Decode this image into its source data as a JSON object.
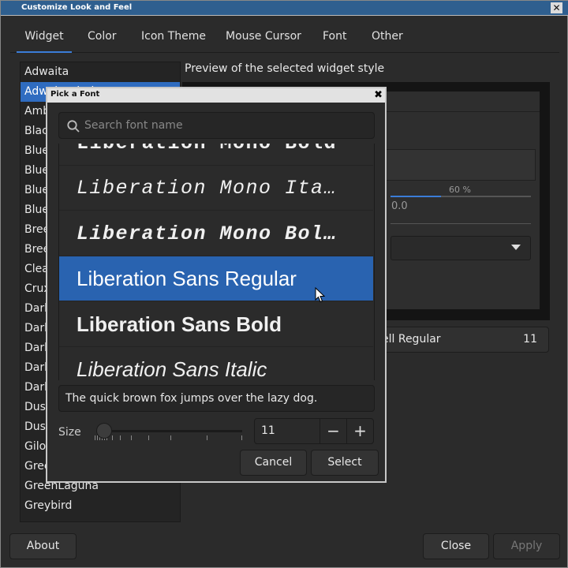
{
  "window": {
    "title": "Customize Look and Feel",
    "close_glyph": "✕"
  },
  "tabs": [
    {
      "label": "Widget",
      "active": true
    },
    {
      "label": "Color"
    },
    {
      "label": "Icon Theme"
    },
    {
      "label": "Mouse Cursor"
    },
    {
      "label": "Font"
    },
    {
      "label": "Other"
    }
  ],
  "themes": [
    "Adwaita",
    "Adwaita-dark",
    "Ambiance",
    "Blackbird",
    "Bluebird",
    "Bluebird-dark",
    "BlueMenta",
    "Blue-Submarine",
    "Breeze",
    "Breeze-Dark",
    "Clearlooks",
    "Crux",
    "Darkbird",
    "Darkcold",
    "Darkfire",
    "Darkmint",
    "Dark-Submarine",
    "Dusk",
    "Dust",
    "Gilouche",
    "Greenbird",
    "GreenLaguna",
    "Greybird"
  ],
  "selected_theme_index": 1,
  "preview": {
    "label": "Preview of the selected widget style",
    "progress_label": "60 %",
    "progress_value": 0.6,
    "value_text": "0.0"
  },
  "font_button": {
    "name": "ell Regular",
    "size": "11"
  },
  "footer": {
    "about": "About",
    "close": "Close",
    "apply": "Apply"
  },
  "dialog": {
    "title": "Pick a Font",
    "close_glyph": "✖",
    "search_placeholder": "Search font name",
    "fonts": [
      {
        "label": "Liberation Mono Bold",
        "family": "mono",
        "style": "bold"
      },
      {
        "label": "Liberation Mono Ita…",
        "family": "mono",
        "style": "italic"
      },
      {
        "label": "Liberation Mono Bol…",
        "family": "mono",
        "style": "bolditalic"
      },
      {
        "label": "Liberation Sans Regular",
        "family": "sans",
        "style": "regular",
        "selected": true
      },
      {
        "label": "Liberation Sans Bold",
        "family": "sans",
        "style": "bold"
      },
      {
        "label": "Liberation Sans Italic",
        "family": "sans",
        "style": "italic"
      }
    ],
    "sample_text": "The quick brown fox jumps over the lazy dog.",
    "size_label": "Size",
    "size_value": "11",
    "minus": "−",
    "plus": "+",
    "cancel": "Cancel",
    "select": "Select"
  }
}
